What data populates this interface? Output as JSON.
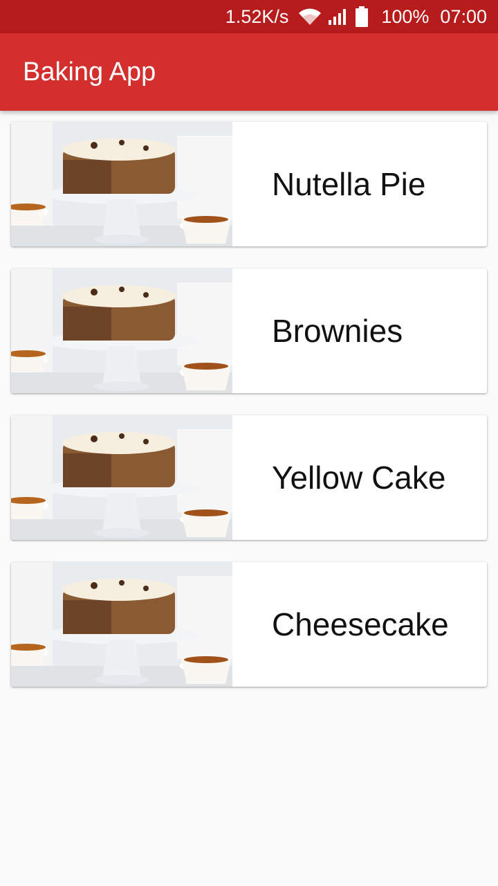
{
  "status_bar": {
    "speed": "1.52K/s",
    "battery": "100%",
    "time": "07:00",
    "icons": [
      "wifi-icon",
      "signal-icon",
      "battery-icon"
    ]
  },
  "app_bar": {
    "title": "Baking App"
  },
  "recipes": [
    {
      "name": "Nutella Pie"
    },
    {
      "name": "Brownies"
    },
    {
      "name": "Yellow Cake"
    },
    {
      "name": "Cheesecake"
    }
  ],
  "colors": {
    "status_bar": "#b71c1c",
    "app_bar": "#d32f2f",
    "background": "#fafafa"
  }
}
